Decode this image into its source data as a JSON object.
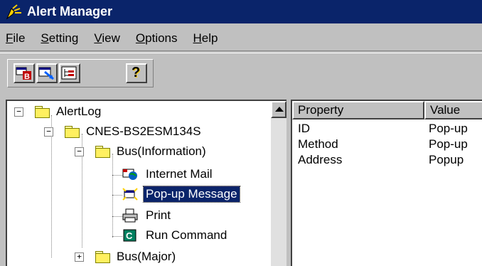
{
  "window": {
    "title": "Alert Manager"
  },
  "menu": [
    {
      "mnemonic": "F",
      "rest": "ile"
    },
    {
      "mnemonic": "S",
      "rest": "etting"
    },
    {
      "mnemonic": "V",
      "rest": "iew"
    },
    {
      "mnemonic": "O",
      "rest": "ptions"
    },
    {
      "mnemonic": "H",
      "rest": "elp"
    }
  ],
  "toolbar": {
    "buttons": [
      "new-bus-icon",
      "properties-icon",
      "tree-view-icon",
      "help-icon"
    ],
    "help_glyph": "?"
  },
  "tree": {
    "nodes": [
      {
        "label": "AlertLog",
        "expander": "−"
      },
      {
        "label": "CNES-BS2ESM134S",
        "expander": "−"
      },
      {
        "label": "Bus(Information)",
        "expander": "−"
      },
      {
        "label": "Internet Mail"
      },
      {
        "label": "Pop-up Message",
        "selected": true
      },
      {
        "label": "Print"
      },
      {
        "label": "Run Command",
        "icon_letter": "C"
      },
      {
        "label": "Bus(Major)",
        "expander": "+"
      }
    ]
  },
  "list": {
    "columns": [
      "Property",
      "Value"
    ],
    "rows": [
      [
        "ID",
        "Pop-up"
      ],
      [
        "Method",
        "Pop-up"
      ],
      [
        "Address",
        "Popup"
      ]
    ]
  },
  "colors": {
    "titlebar": "#0a246a",
    "selection": "#0a246a",
    "face": "#c0c0c0"
  }
}
